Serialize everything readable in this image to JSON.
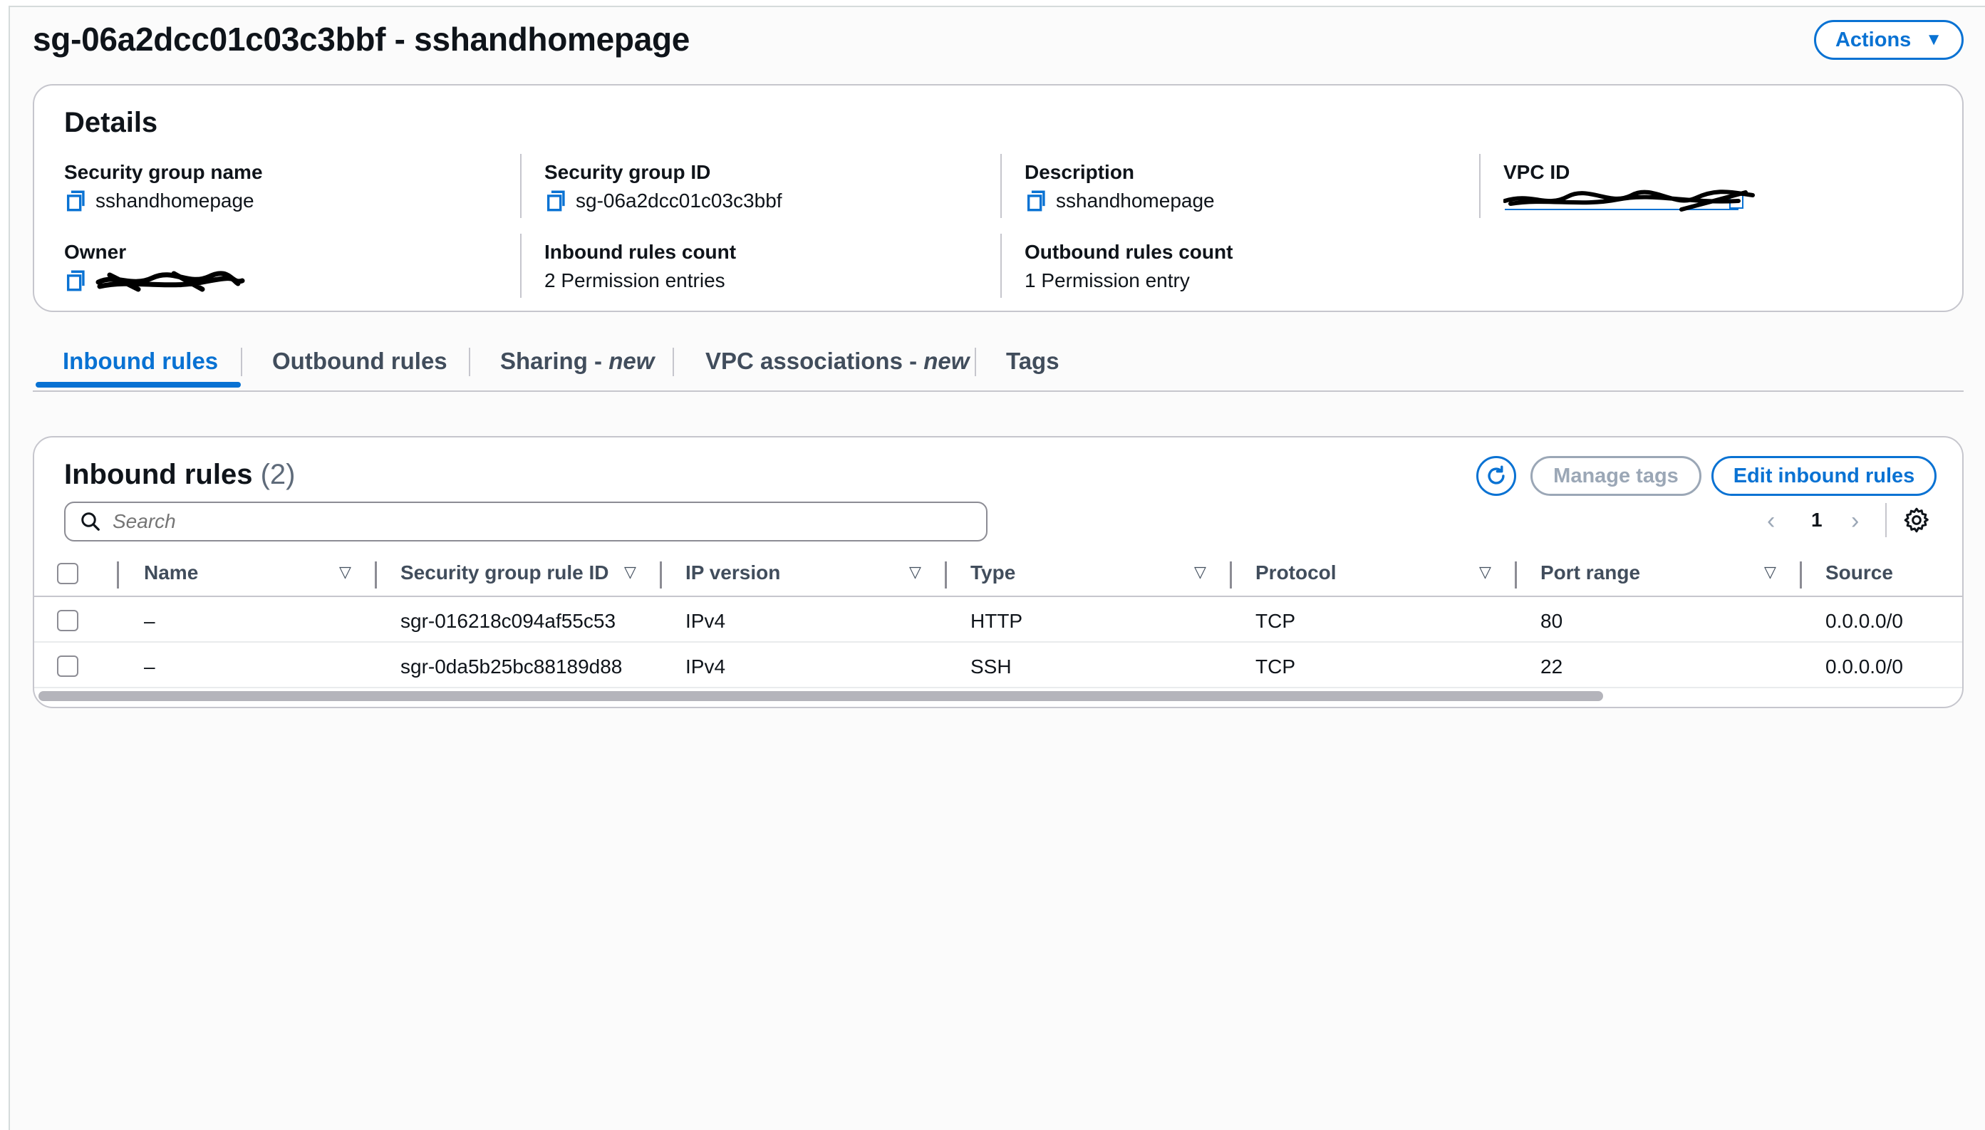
{
  "header": {
    "title": "sg-06a2dcc01c03c3bbf - sshandhomepage",
    "actions_label": "Actions"
  },
  "details": {
    "heading": "Details",
    "fields": {
      "sg_name": {
        "label": "Security group name",
        "value": "sshandhomepage"
      },
      "sg_id": {
        "label": "Security group ID",
        "value": "sg-06a2dcc01c03c3bbf"
      },
      "description": {
        "label": "Description",
        "value": "sshandhomepage"
      },
      "vpc_id": {
        "label": "VPC ID",
        "value": ""
      },
      "owner": {
        "label": "Owner",
        "value": ""
      },
      "inbound_count": {
        "label": "Inbound rules count",
        "value": "2 Permission entries"
      },
      "outbound_count": {
        "label": "Outbound rules count",
        "value": "1 Permission entry"
      }
    }
  },
  "tabs": [
    {
      "label": "Inbound rules",
      "suffix": "",
      "active": true
    },
    {
      "label": "Outbound rules",
      "suffix": "",
      "active": false
    },
    {
      "label": "Sharing - ",
      "suffix": "new",
      "active": false
    },
    {
      "label": "VPC associations - ",
      "suffix": "new",
      "active": false
    },
    {
      "label": "Tags",
      "suffix": "",
      "active": false
    }
  ],
  "rules": {
    "heading": "Inbound rules",
    "count": "(2)",
    "manage_tags_label": "Manage tags",
    "edit_label": "Edit inbound rules",
    "search_placeholder": "Search",
    "page": "1",
    "columns": [
      "Name",
      "Security group rule ID",
      "IP version",
      "Type",
      "Protocol",
      "Port range",
      "Source"
    ],
    "rows": [
      [
        "–",
        "sgr-016218c094af55c53",
        "IPv4",
        "HTTP",
        "TCP",
        "80",
        "0.0.0.0/0"
      ],
      [
        "–",
        "sgr-0da5b25bc88189d88",
        "IPv4",
        "SSH",
        "TCP",
        "22",
        "0.0.0.0/0"
      ]
    ]
  },
  "colors": {
    "accent": "#0972d3",
    "text": "#0f141a",
    "border": "#c6c6cd",
    "disabled": "#9ba7b6"
  }
}
